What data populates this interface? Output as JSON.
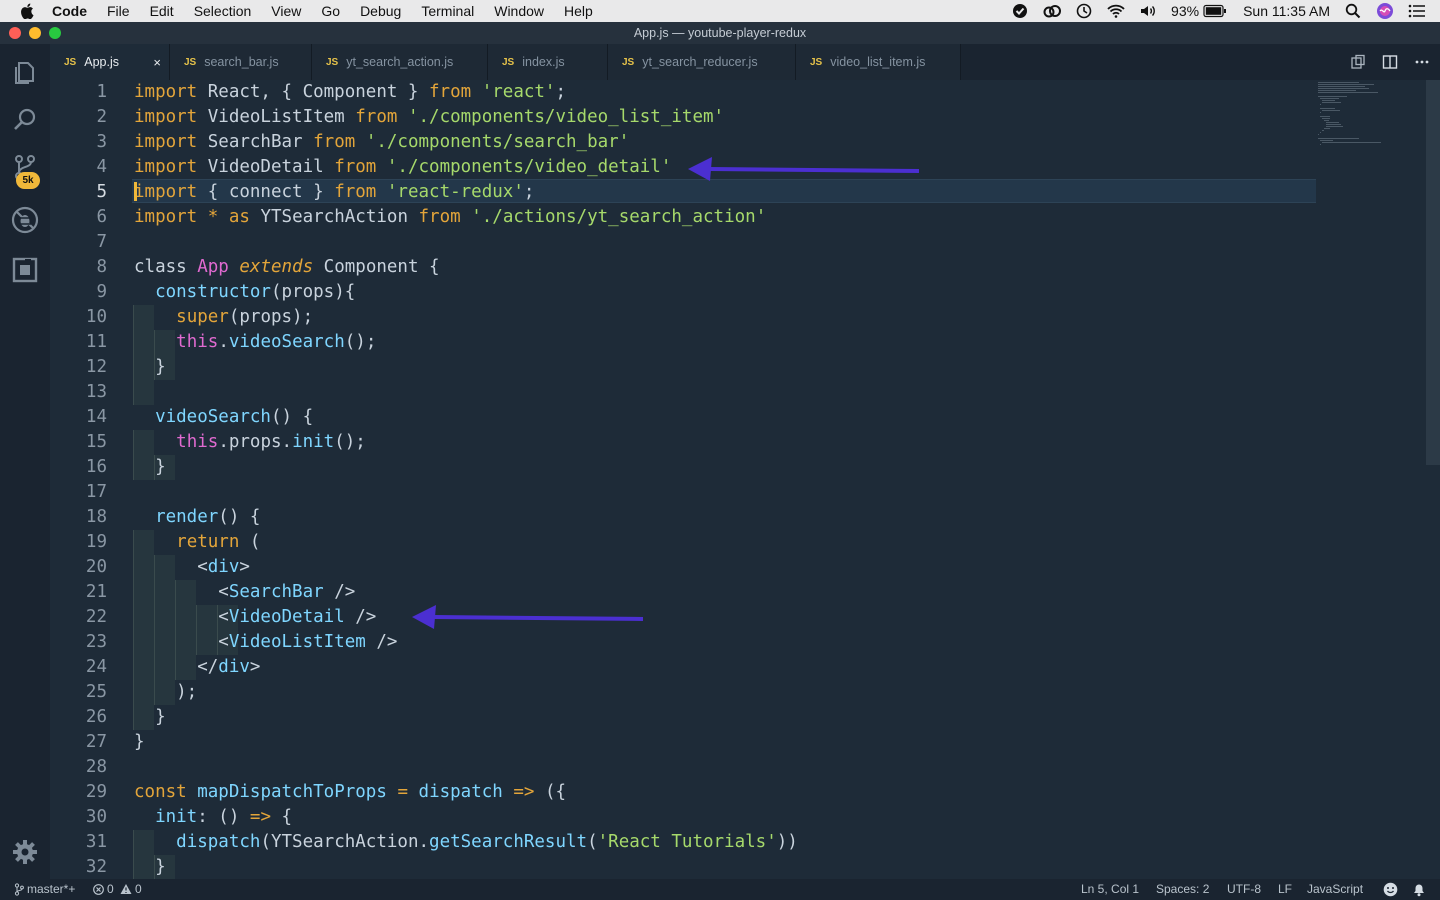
{
  "menubar": {
    "items": [
      "Code",
      "File",
      "Edit",
      "Selection",
      "View",
      "Go",
      "Debug",
      "Terminal",
      "Window",
      "Help"
    ],
    "battery": "93%",
    "clock": "Sun 11:35 AM"
  },
  "window": {
    "title": "App.js — youtube-player-redux"
  },
  "activitybar": {
    "icons": [
      "explorer-icon",
      "search-icon",
      "source-control-icon",
      "debug-icon",
      "extensions-icon",
      "settings-gear-icon"
    ],
    "scm_badge": "5k"
  },
  "tabs": [
    {
      "label": "App.js",
      "badge": "JS",
      "active": true
    },
    {
      "label": "search_bar.js",
      "badge": "JS"
    },
    {
      "label": "yt_search_action.js",
      "badge": "JS"
    },
    {
      "label": "index.js",
      "badge": "JS"
    },
    {
      "label": "yt_search_reducer.js",
      "badge": "JS"
    },
    {
      "label": "video_list_item.js",
      "badge": "JS"
    }
  ],
  "tab_close": "×",
  "code": [
    "import React, { Component } from 'react';",
    "import VideoListItem from './components/video_list_item'",
    "import SearchBar from './components/search_bar'",
    "import VideoDetail from './components/video_detail'",
    "import { connect } from 'react-redux';",
    "import * as YTSearchAction from './actions/yt_search_action'",
    "",
    "class App extends Component {",
    "  constructor(props){",
    "    super(props);",
    "    this.videoSearch();",
    "  }",
    "",
    "  videoSearch() {",
    "    this.props.init();",
    "  }",
    "",
    "  render() {",
    "    return (",
    "      <div>",
    "        <SearchBar />",
    "        <VideoDetail />",
    "        <VideoListItem />",
    "      </div>",
    "    );",
    "  }",
    "}",
    "",
    "const mapDispatchToProps = dispatch => ({",
    "  init: () => {",
    "    dispatch(YTSearchAction.getSearchResult('React Tutorials'))",
    "  }"
  ],
  "current_line": 5,
  "statusbar": {
    "branch": "master*+",
    "errors": "0",
    "warnings": "0",
    "position": "Ln 5, Col 1",
    "spaces": "Spaces: 2",
    "encoding": "UTF-8",
    "eol": "LF",
    "language": "JavaScript"
  },
  "colors": {
    "keyword": "#e3a53a",
    "string": "#a6d96b",
    "function": "#7fd6ff",
    "this": "#e06ad0",
    "annotation_arrow": "#4b2fd1"
  }
}
